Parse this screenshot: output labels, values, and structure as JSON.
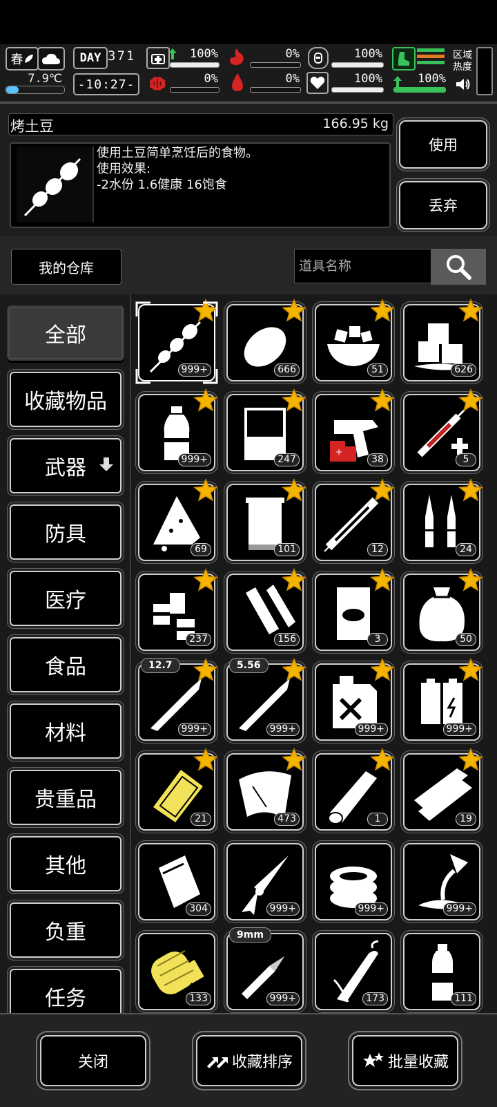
{
  "hud": {
    "season": "春",
    "temperature": "7.9℃",
    "day_label": "DAY",
    "day_number": "371",
    "clock": "-10:27-",
    "stats": {
      "health": "100%",
      "stomach": "0%",
      "stamina": "100%",
      "brain": "0%",
      "blood": "0%",
      "heart": "100%",
      "carry": "100%"
    },
    "stat_fills": {
      "health": 1.0,
      "stomach": 0.0,
      "stamina": 1.0,
      "brain": 0.0,
      "blood": 0.0,
      "heart": 1.0,
      "carry": 1.0
    },
    "zone_heat": "区域热度",
    "colors": {
      "accent_green": "#39c25a",
      "accent_orange": "#e07a1c",
      "accent_red": "#d42424",
      "temp_blue": "#58c4ff"
    }
  },
  "selected_item": {
    "name": "烤土豆",
    "weight": "166.95 kg",
    "description": "使用土豆简单烹饪后的食物。",
    "effect_label": "使用效果:",
    "effect_values": "-2水份 1.6健康 16饱食",
    "use_button": "使用",
    "discard_button": "丢弃"
  },
  "warehouse": {
    "label": "我的仓库",
    "search_placeholder": "道具名称"
  },
  "categories": [
    {
      "label": "全部",
      "active": true
    },
    {
      "label": "收藏物品"
    },
    {
      "label": "武器"
    },
    {
      "label": "防具"
    },
    {
      "label": "医疗"
    },
    {
      "label": "食品"
    },
    {
      "label": "材料"
    },
    {
      "label": "贵重品"
    },
    {
      "label": "其他"
    },
    {
      "label": "负重"
    },
    {
      "label": "任务"
    }
  ],
  "items": [
    {
      "icon": "roasted-potato-skewer-icon",
      "count": "999+",
      "fav": true,
      "selected": true
    },
    {
      "icon": "potato-icon",
      "count": "666",
      "fav": true
    },
    {
      "icon": "bowl-of-cubes-icon",
      "count": "51",
      "fav": true
    },
    {
      "icon": "ice-cubes-icon",
      "count": "626",
      "fav": true
    },
    {
      "icon": "water-bottle-icon",
      "count": "999+",
      "fav": true
    },
    {
      "icon": "beaker-icon",
      "count": "247",
      "fav": true
    },
    {
      "icon": "flare-gun-icon",
      "count": "38",
      "fav": true
    },
    {
      "icon": "adrenaline-syringe-icon",
      "count": "5",
      "fav": true
    },
    {
      "icon": "bandage-icon",
      "count": "69",
      "fav": true
    },
    {
      "icon": "towel-icon",
      "count": "101",
      "fav": true
    },
    {
      "icon": "syringe-icon",
      "count": "12",
      "fav": true
    },
    {
      "icon": "ampoules-icon",
      "count": "24",
      "fav": true
    },
    {
      "icon": "pill-bottles-icon",
      "count": "237",
      "fav": true
    },
    {
      "icon": "paper-rolls-icon",
      "count": "156",
      "fav": true
    },
    {
      "icon": "seed-bag-icon",
      "count": "3",
      "fav": true
    },
    {
      "icon": "sack-icon",
      "count": "50",
      "fav": true
    },
    {
      "icon": "rifle-round-icon",
      "count": "999+",
      "fav": true,
      "caliber": "12.7"
    },
    {
      "icon": "rifle-round-icon",
      "count": "999+",
      "fav": true,
      "caliber": "5.56"
    },
    {
      "icon": "fuel-can-icon",
      "count": "999+",
      "fav": true
    },
    {
      "icon": "batteries-icon",
      "count": "999+",
      "fav": true
    },
    {
      "icon": "gold-plate-icon",
      "count": "21",
      "fav": true
    },
    {
      "icon": "cloth-icon",
      "count": "473",
      "fav": true
    },
    {
      "icon": "log-icon",
      "count": "1",
      "fav": true
    },
    {
      "icon": "planks-icon",
      "count": "19",
      "fav": true
    },
    {
      "icon": "plastic-bag-icon",
      "count": "304",
      "fav": false
    },
    {
      "icon": "rocket-icon",
      "count": "999+",
      "fav": false
    },
    {
      "icon": "tape-roll-icon",
      "count": "999+",
      "fav": false
    },
    {
      "icon": "funnel-pour-icon",
      "count": "999+",
      "fav": false
    },
    {
      "icon": "spring-icon",
      "count": "133",
      "fav": false
    },
    {
      "icon": "pistol-round-icon",
      "count": "999+",
      "fav": false,
      "caliber": "9mm"
    },
    {
      "icon": "corn-icon",
      "count": "173",
      "fav": false
    },
    {
      "icon": "plastic-bottle-icon",
      "count": "111",
      "fav": false
    }
  ],
  "footer": {
    "close": "关闭",
    "sort_favorites": "收藏排序",
    "batch_favorite": "批量收藏"
  }
}
